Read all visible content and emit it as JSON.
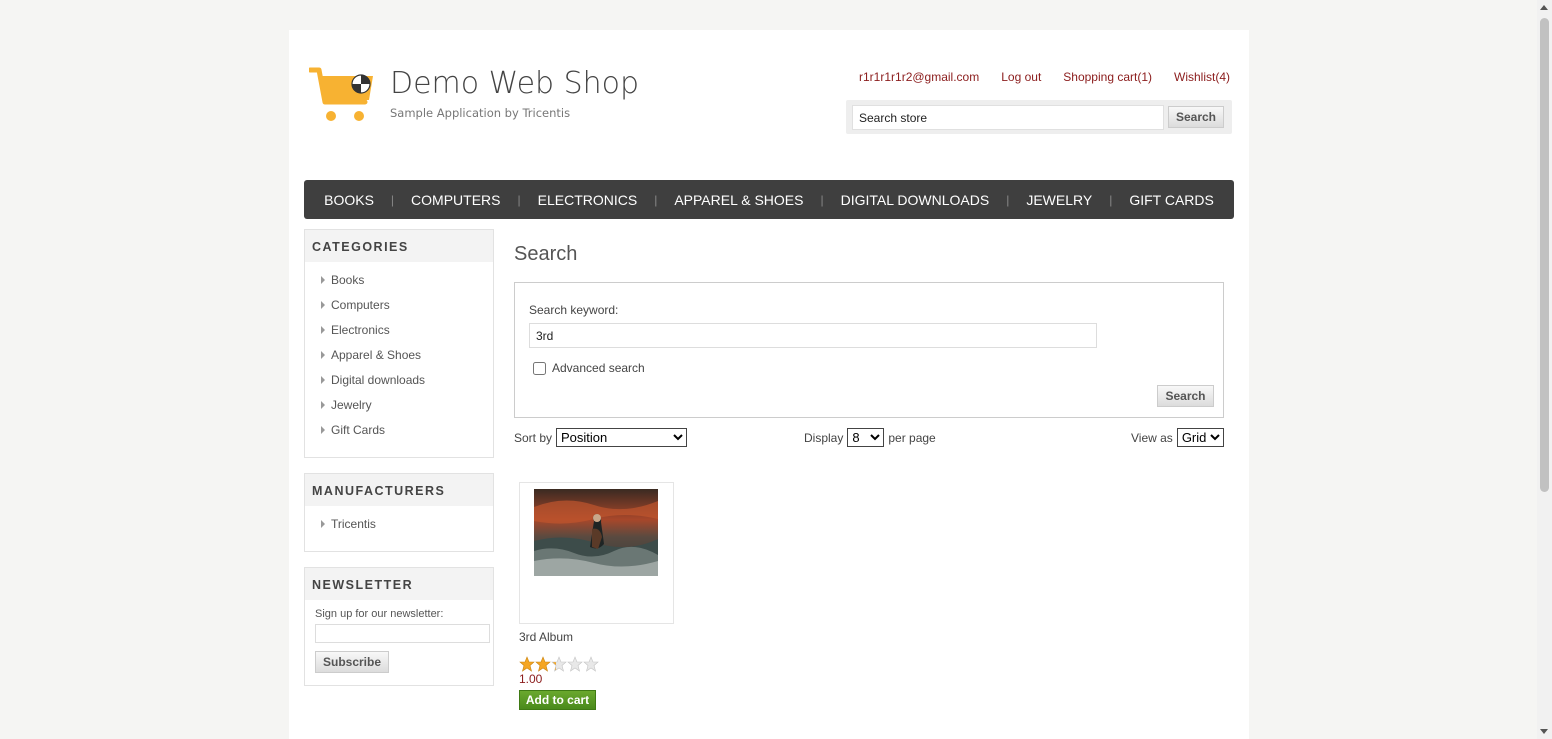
{
  "header": {
    "logo_title": "Demo Web Shop",
    "logo_subtitle": "Sample Application by Tricentis",
    "links": {
      "account": "r1r1r1r1r2@gmail.com",
      "logout": "Log out",
      "cart": "Shopping cart(1)",
      "wishlist": "Wishlist(4)"
    },
    "search": {
      "value": "Search store",
      "button": "Search"
    }
  },
  "topmenu": [
    "BOOKS",
    "COMPUTERS",
    "ELECTRONICS",
    "APPAREL & SHOES",
    "DIGITAL DOWNLOADS",
    "JEWELRY",
    "GIFT CARDS"
  ],
  "sidebar": {
    "categories": {
      "title": "CATEGORIES",
      "items": [
        "Books",
        "Computers",
        "Electronics",
        "Apparel & Shoes",
        "Digital downloads",
        "Jewelry",
        "Gift Cards"
      ]
    },
    "manufacturers": {
      "title": "MANUFACTURERS",
      "items": [
        "Tricentis"
      ]
    },
    "newsletter": {
      "title": "NEWSLETTER",
      "label": "Sign up for our newsletter:",
      "button": "Subscribe"
    }
  },
  "main": {
    "title": "Search",
    "keyword_label": "Search keyword:",
    "keyword_value": "3rd",
    "advanced_label": "Advanced search",
    "search_button": "Search",
    "sort_label": "Sort by",
    "sort_value": "Position",
    "display_label": "Display",
    "display_value": "8",
    "per_page_label": "per page",
    "view_label": "View as",
    "view_value": "Grid"
  },
  "products": [
    {
      "name": "3rd Album",
      "rating": 2,
      "rating_max": 5,
      "price": "1.00",
      "add_button": "Add to cart"
    }
  ],
  "colors": {
    "link": "#8b1c1c",
    "menu_bg": "#3f3f3f",
    "add_to_cart": "#5a9a24",
    "logo_orange": "#f7b232"
  }
}
